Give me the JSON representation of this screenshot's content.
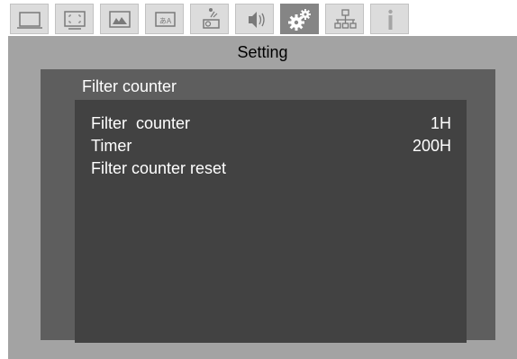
{
  "tabs": [
    {
      "icon": "picture-icon"
    },
    {
      "icon": "position-icon"
    },
    {
      "icon": "advanced-menu-icon"
    },
    {
      "icon": "display-language-icon"
    },
    {
      "icon": "projector-setting-icon"
    },
    {
      "icon": "audio-icon"
    },
    {
      "icon": "setting-gears-icon",
      "active": true
    },
    {
      "icon": "network-icon"
    },
    {
      "icon": "information-icon"
    }
  ],
  "header": {
    "title": "Setting"
  },
  "section": {
    "title": "Filter counter",
    "rows": [
      {
        "label": "Filter  counter",
        "value": "1H"
      },
      {
        "label": "Timer",
        "value": "200H"
      },
      {
        "label": "Filter counter reset",
        "value": ""
      }
    ]
  },
  "colors": {
    "active_tab": "#858585",
    "panel": "#a3a3a3",
    "subpanel": "#5e5e5e",
    "content": "#424242",
    "text": "#ffffff"
  }
}
